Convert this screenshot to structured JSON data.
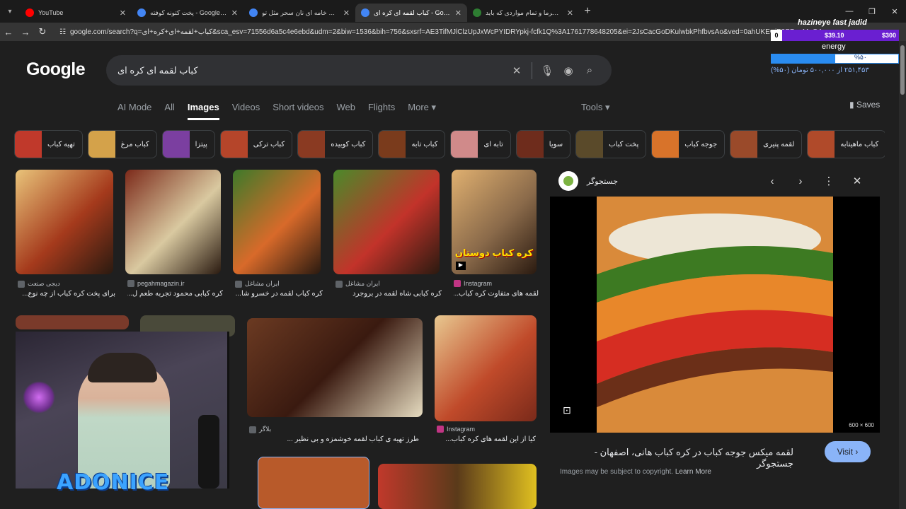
{
  "tabs": [
    {
      "title": "YouTube",
      "color": "#ff0000"
    },
    {
      "title": "پخت کتونه کوفته - Google Search",
      "color": "#4285f4"
    },
    {
      "title": "نون خامه ای نان سحر مثل تو - Google Search",
      "color": "#4285f4"
    },
    {
      "title": "کباب لقمه ای کره ای - Google Search",
      "color": "#4285f4",
      "active": true
    },
    {
      "title": "الکل خرما و تمام مواردی که باید ...",
      "color": "#2e7d32"
    }
  ],
  "url": "google.com/search?q=کباب+لقمه+ای+کره+ای&sca_esv=71556d6a5c4e6ebd&udm=2&biw=1536&bih=756&sxsrf=AE3TifMJlClzUpJxWcPYIDRYpkj-fcfk1Q%3A1761778648205&ei=2JsCacGoDKulwbkPhfbvsAo&ved=0ahUKEwjB9P7zwMqQA...",
  "search": {
    "logo": "Google",
    "query": "کباب لقمه ای کره ای"
  },
  "nav_tabs": [
    "AI Mode",
    "All",
    "Images",
    "Videos",
    "Short videos",
    "Web",
    "Flights",
    "More ▾"
  ],
  "active_nav": "Images",
  "tools_label": "Tools ▾",
  "saves_label": "Saves",
  "chips": [
    {
      "label": "تهیه کباب",
      "color": "#c0392b"
    },
    {
      "label": "کباب مرغ",
      "color": "#d4a24a"
    },
    {
      "label": "پیتزا",
      "color": "#7b3fa0"
    },
    {
      "label": "کباب ترکی",
      "color": "#b5452a"
    },
    {
      "label": "کباب کوبیده",
      "color": "#8a3a22"
    },
    {
      "label": "کباب تابه",
      "color": "#7a3b1c"
    },
    {
      "label": "تابه ای",
      "color": "#d08a8a"
    },
    {
      "label": "سویا",
      "color": "#6e2c1c"
    },
    {
      "label": "پخت کباب",
      "color": "#5a4a2a"
    },
    {
      "label": "جوجه کباب",
      "color": "#d8732a"
    },
    {
      "label": "لقمه پنیری",
      "color": "#9a4a2a"
    },
    {
      "label": "کباب ماهیتابه",
      "color": "#b04a2a"
    }
  ],
  "results_row1": [
    {
      "source": "دیجی صنعت",
      "caption": "برای پخت کره کباب از چه نوع...",
      "c1": "#a53a1c",
      "c2": "#e9c47a"
    },
    {
      "source": "pegahmagazin.ir",
      "caption": "کره کبابی محمود تجربه طعم ل...",
      "c1": "#d9c9a0",
      "c2": "#7c2a1a"
    },
    {
      "source": "ایران مشاغل",
      "caption": "کره کباب لقمه در خسرو شا...",
      "c1": "#d86a2a",
      "c2": "#3d7a2a"
    },
    {
      "source": "ایران مشاغل",
      "caption": "کره کبابی شاه لقمه در بروجرد",
      "c1": "#c2332a",
      "c2": "#4a8a2a"
    },
    {
      "source": "Instagram",
      "caption": "لقمه های متفاوت کره کباب...",
      "c1": "#8a6a4a",
      "c2": "#e0b070"
    }
  ],
  "overlay_text": "کره کباب دوستان",
  "results_row2": [
    {
      "source": "بلاگر",
      "caption": "طرز تهیه ی کباب لقمه خوشمزه و بی نظیر ...",
      "c1": "#6b3a22",
      "c2": "#e6dcc0"
    },
    {
      "source": "Instagram",
      "caption": "کیا از این لقمه های کره کباب...",
      "c1": "#c04a2a",
      "c2": "#e8c890"
    }
  ],
  "panel": {
    "site": "جستجوگر",
    "title": "لقمه میکس جوجه کباب در کره کباب هانی، اصفهان - جستجوگر",
    "resolution": "600 × 600",
    "visit": "Visit",
    "copyright": "Images may be subject to copyright.",
    "learn_more": "Learn More"
  },
  "stream_overlay": {
    "title": "hazineye fast jadid",
    "bar_left": "0",
    "bar_mid": "$39.10",
    "bar_right": "$300",
    "energy_label": "energy",
    "energy_pct": "%۵۰",
    "energy_fraction": 0.5,
    "money": "۲۵۱,۴۵۳ از ۵۰۰,۰۰۰ تومان (۵۰%)"
  },
  "brand": "ADONICE"
}
